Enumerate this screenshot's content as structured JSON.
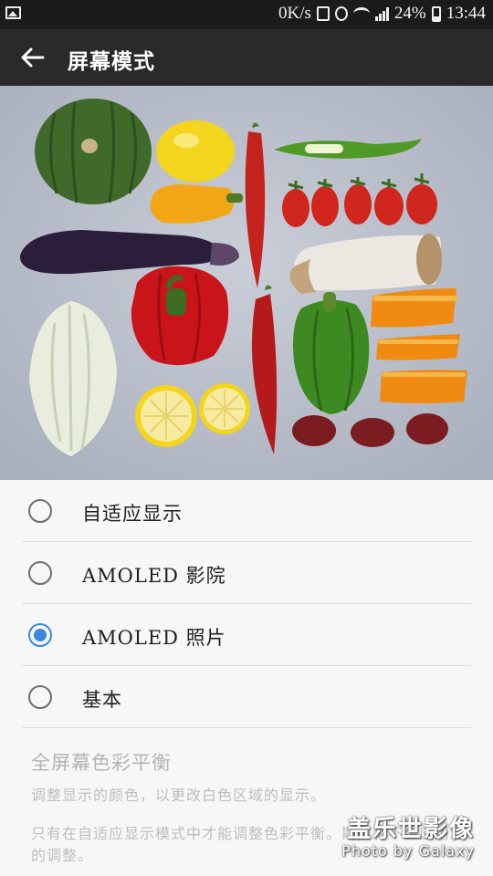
{
  "status_bar": {
    "speed": "0K/s",
    "battery": "24%",
    "time": "13:44"
  },
  "app_bar": {
    "title": "屏幕模式"
  },
  "preview": {
    "description_icon": "vegetables-photo"
  },
  "modes": [
    {
      "label": "自适应显示",
      "selected": false
    },
    {
      "label": "AMOLED 影院",
      "selected": false
    },
    {
      "label": "AMOLED 照片",
      "selected": true
    },
    {
      "label": "基本",
      "selected": false
    }
  ],
  "color_balance": {
    "title": "全屏幕色彩平衡",
    "description": "调整显示的颜色，以更改白色区域的显示。",
    "note": "只有在自适应显示模式中才能调整色彩平衡。期间将不会应用您的调整。"
  },
  "watermark": {
    "line1": "盖乐世影像",
    "line2": "Photo by Galaxy"
  },
  "colors": {
    "accent": "#3e86dd",
    "app_bar": "#2a2a2a",
    "status_bar": "#1b1b1b"
  }
}
